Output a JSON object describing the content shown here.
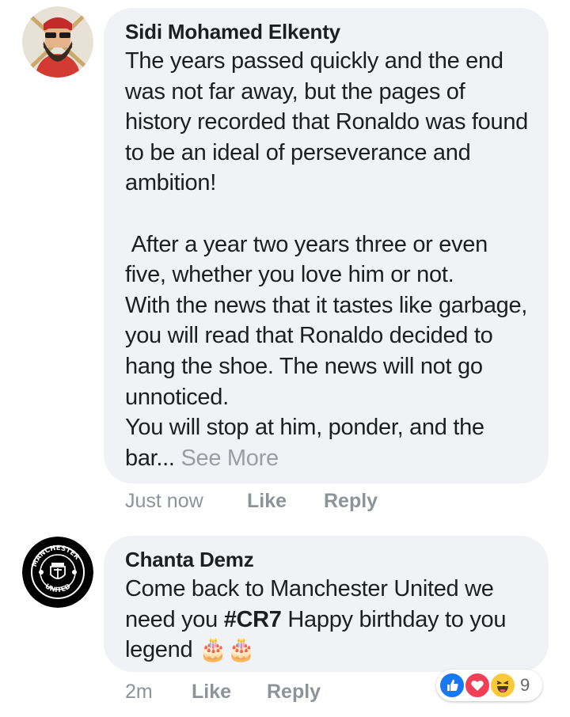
{
  "comments": [
    {
      "author": "Sidi Mohamed Elkenty",
      "text": "The years passed quickly and the end was not far away, but the pages of history recorded that Ronaldo was found to be an ideal of perseverance and ambition!\n\n After a year two years three or even five, whether you love him or not.\nWith the news that it tastes like garbage, you will read that Ronaldo decided to hang the shoe. The news will not go unnoticed.\nYou will stop at him, ponder, and the bar...",
      "see_more": "See More",
      "timestamp": "Just now",
      "like_label": "Like",
      "reply_label": "Reply"
    },
    {
      "author": "Chanta Demz",
      "text_before": "Come back to Manchester United we need you ",
      "hashtag": "#CR7",
      "text_after": " Happy birthday to you legend ",
      "emoji": "🎂🎂",
      "timestamp": "2m",
      "like_label": "Like",
      "reply_label": "Reply",
      "reactions": {
        "icons": [
          "like-icon",
          "love-icon",
          "haha-icon"
        ],
        "count": "9"
      }
    }
  ],
  "colors": {
    "bubble": "#f0f2f5",
    "meta_text": "#8e9399",
    "like_blue": "#1877f2",
    "love_red": "#f33e58",
    "haha_yellow": "#fcc93a"
  }
}
